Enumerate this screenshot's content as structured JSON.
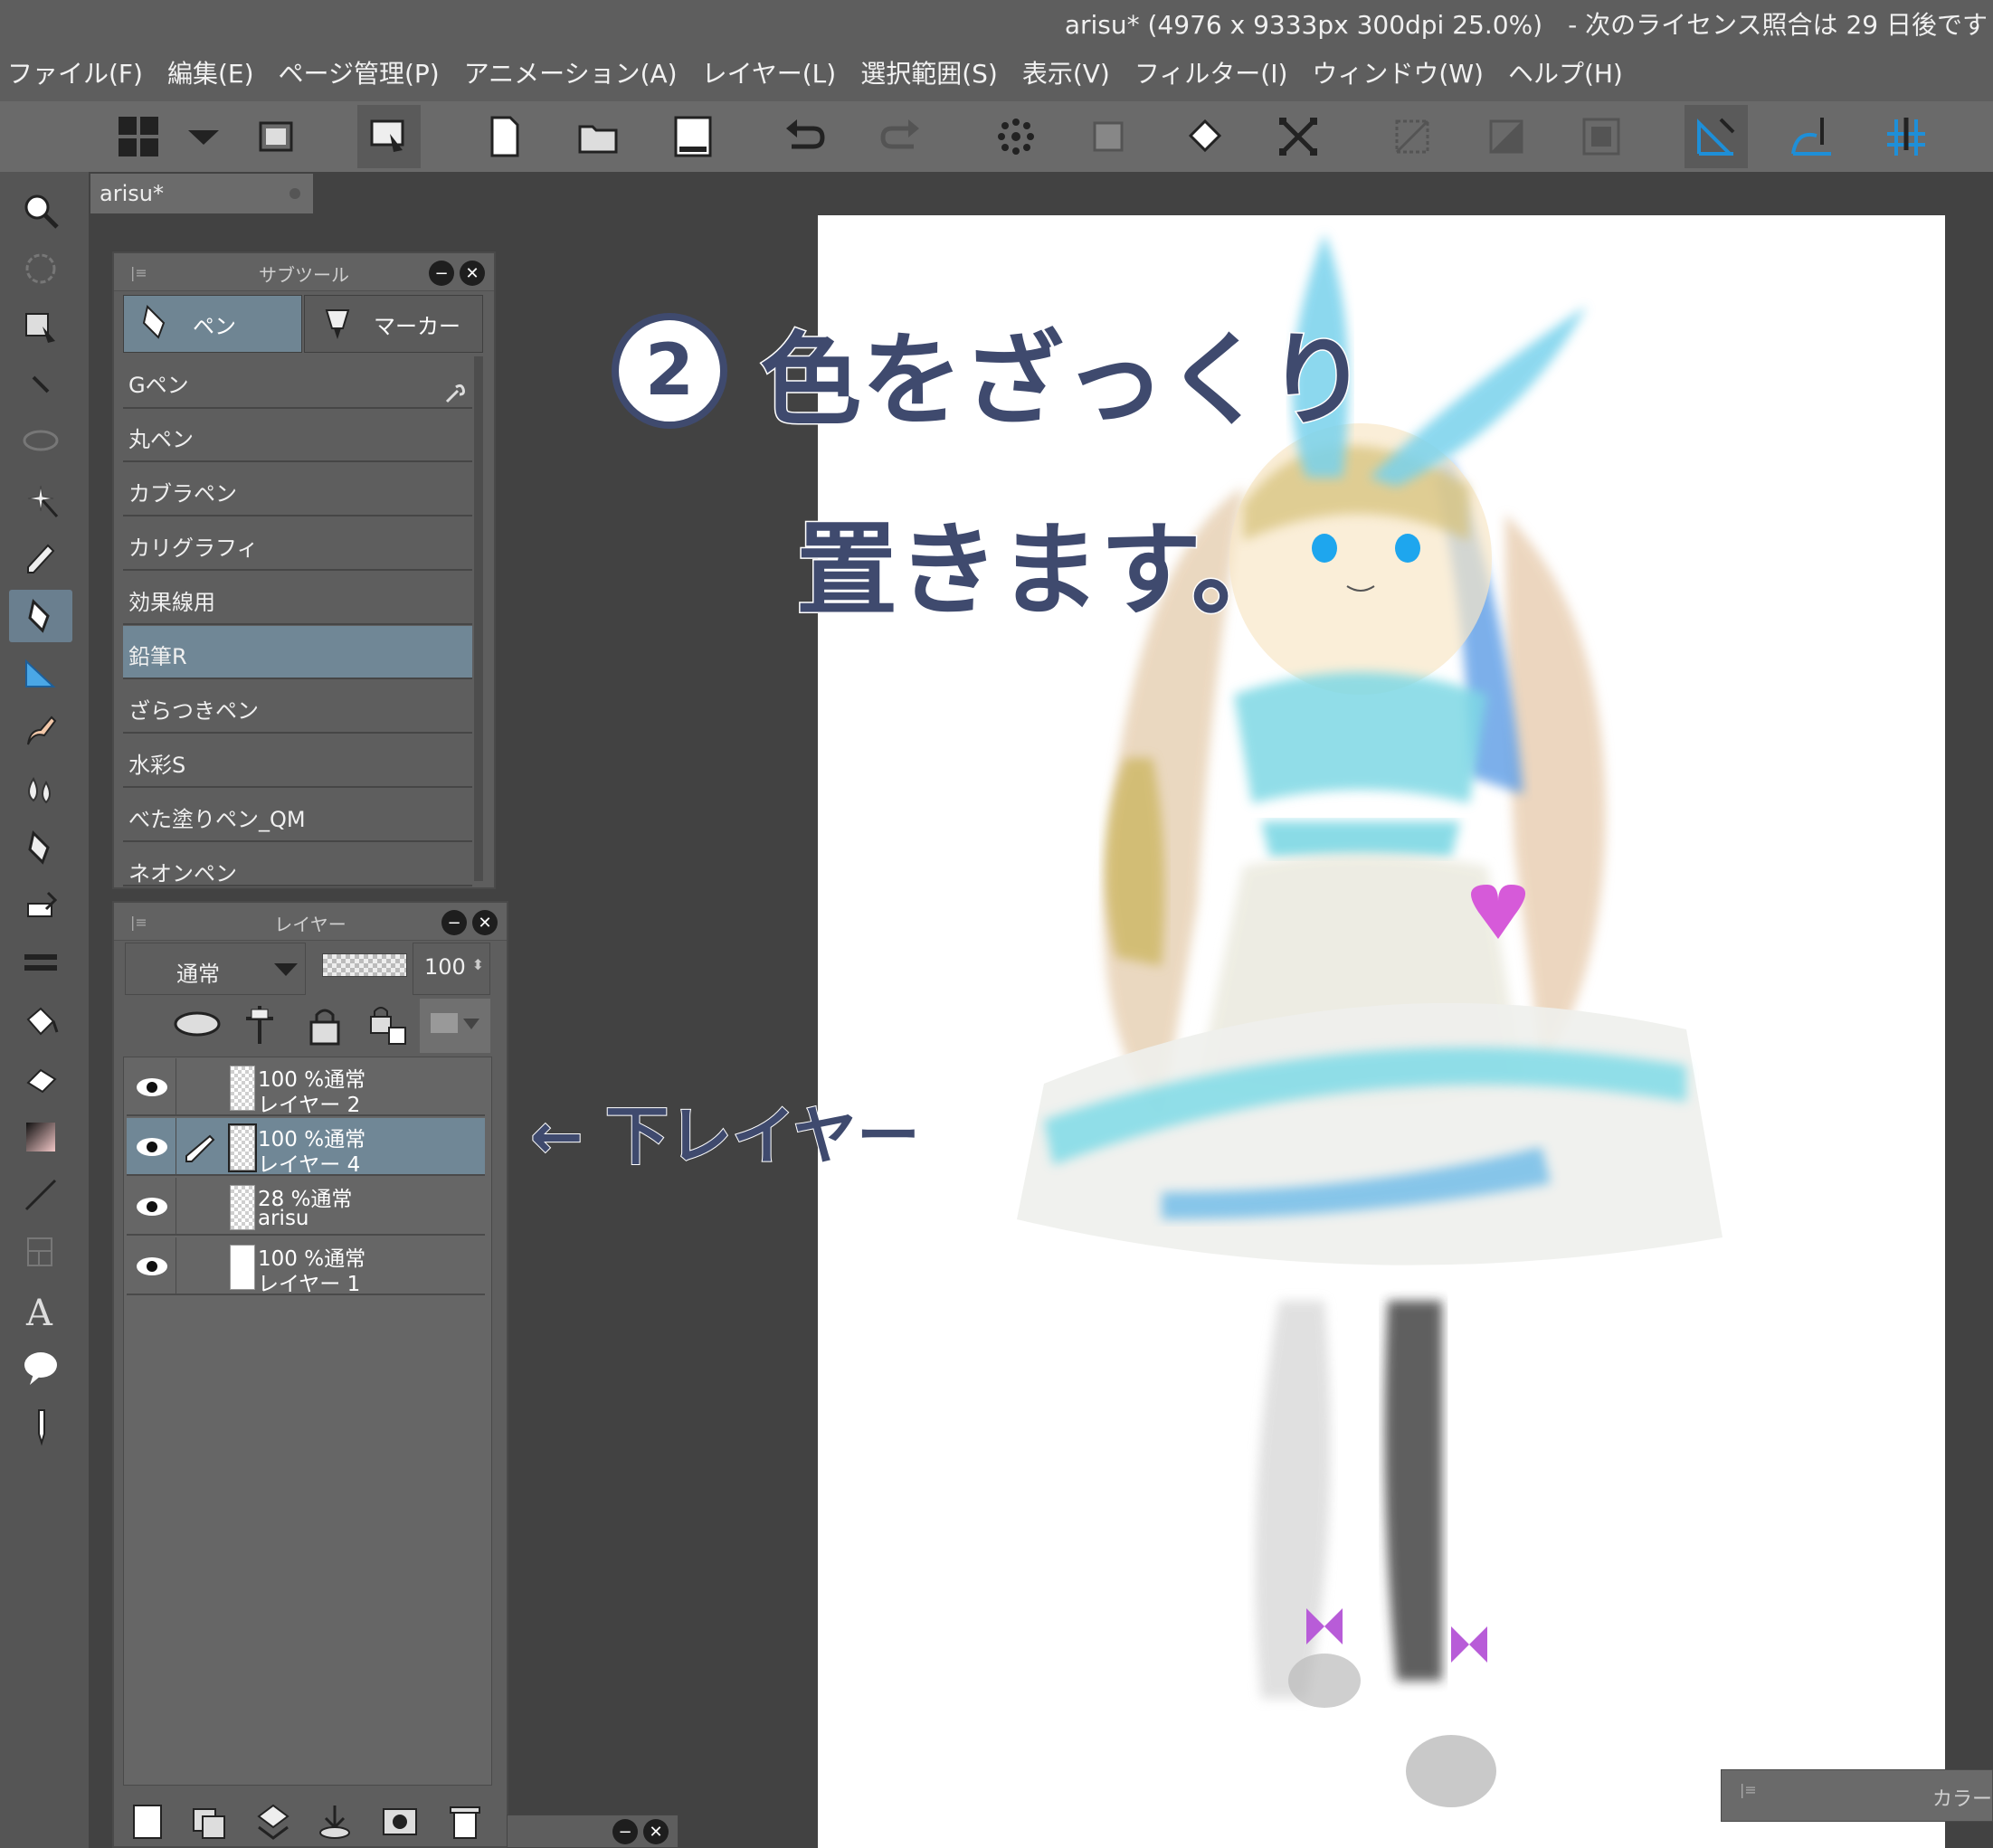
{
  "window": {
    "title": "arisu* (4976 x 9333px 300dpi 25.0%)　- 次のライセンス照合は 29 日後です"
  },
  "menu": [
    "ファイル(F)",
    "編集(E)",
    "ページ管理(P)",
    "アニメーション(A)",
    "レイヤー(L)",
    "選択範囲(S)",
    "表示(V)",
    "フィルター(I)",
    "ウィンドウ(W)",
    "ヘルプ(H)"
  ],
  "toolbar": {
    "icons": [
      "grid-layout-icon",
      "dropdown-icon",
      "fit-screen-icon",
      "hand-edit-icon",
      "new-file-icon",
      "open-folder-icon",
      "save-icon",
      "undo-icon",
      "redo-icon",
      "dots-icon",
      "transform-icon",
      "fill-icon",
      "transform-x-icon",
      "border-icon",
      "gradient-icon",
      "grid-icon",
      "ruler-icon",
      "curve-icon",
      "perspective-icon"
    ]
  },
  "document": {
    "tab_label": "arisu*"
  },
  "subtool": {
    "title": "サブツール",
    "tabs": [
      "ペン",
      "マーカー"
    ],
    "items": [
      "Gペン",
      "丸ペン",
      "カブラペン",
      "カリグラフィ",
      "効果線用",
      "鉛筆R",
      "ざらつきペン",
      "水彩S",
      "べた塗りペン_QM",
      "ネオンペン"
    ],
    "selected_index": 5
  },
  "layer_panel": {
    "title": "レイヤー",
    "blend_mode": "通常",
    "opacity": "100",
    "layers": [
      {
        "line1": "100 %通常",
        "line2": "レイヤー 2",
        "selected": false,
        "edit": false
      },
      {
        "line1": "100 %通常",
        "line2": "レイヤー 4",
        "selected": true,
        "edit": true
      },
      {
        "line1": "28 %通常",
        "line2": "arisu",
        "selected": false,
        "edit": false
      },
      {
        "line1": "100 %通常",
        "line2": "レイヤー 1",
        "selected": false,
        "edit": false
      }
    ]
  },
  "color_panel": {
    "title": "カラー"
  },
  "annotations": {
    "step_number": "2",
    "line1": "色をざっくり",
    "line2": "置きます。",
    "arrow_note": "← 下レイヤー"
  },
  "colors": {
    "accent": "#708796",
    "ink": "#3f4a6e"
  }
}
